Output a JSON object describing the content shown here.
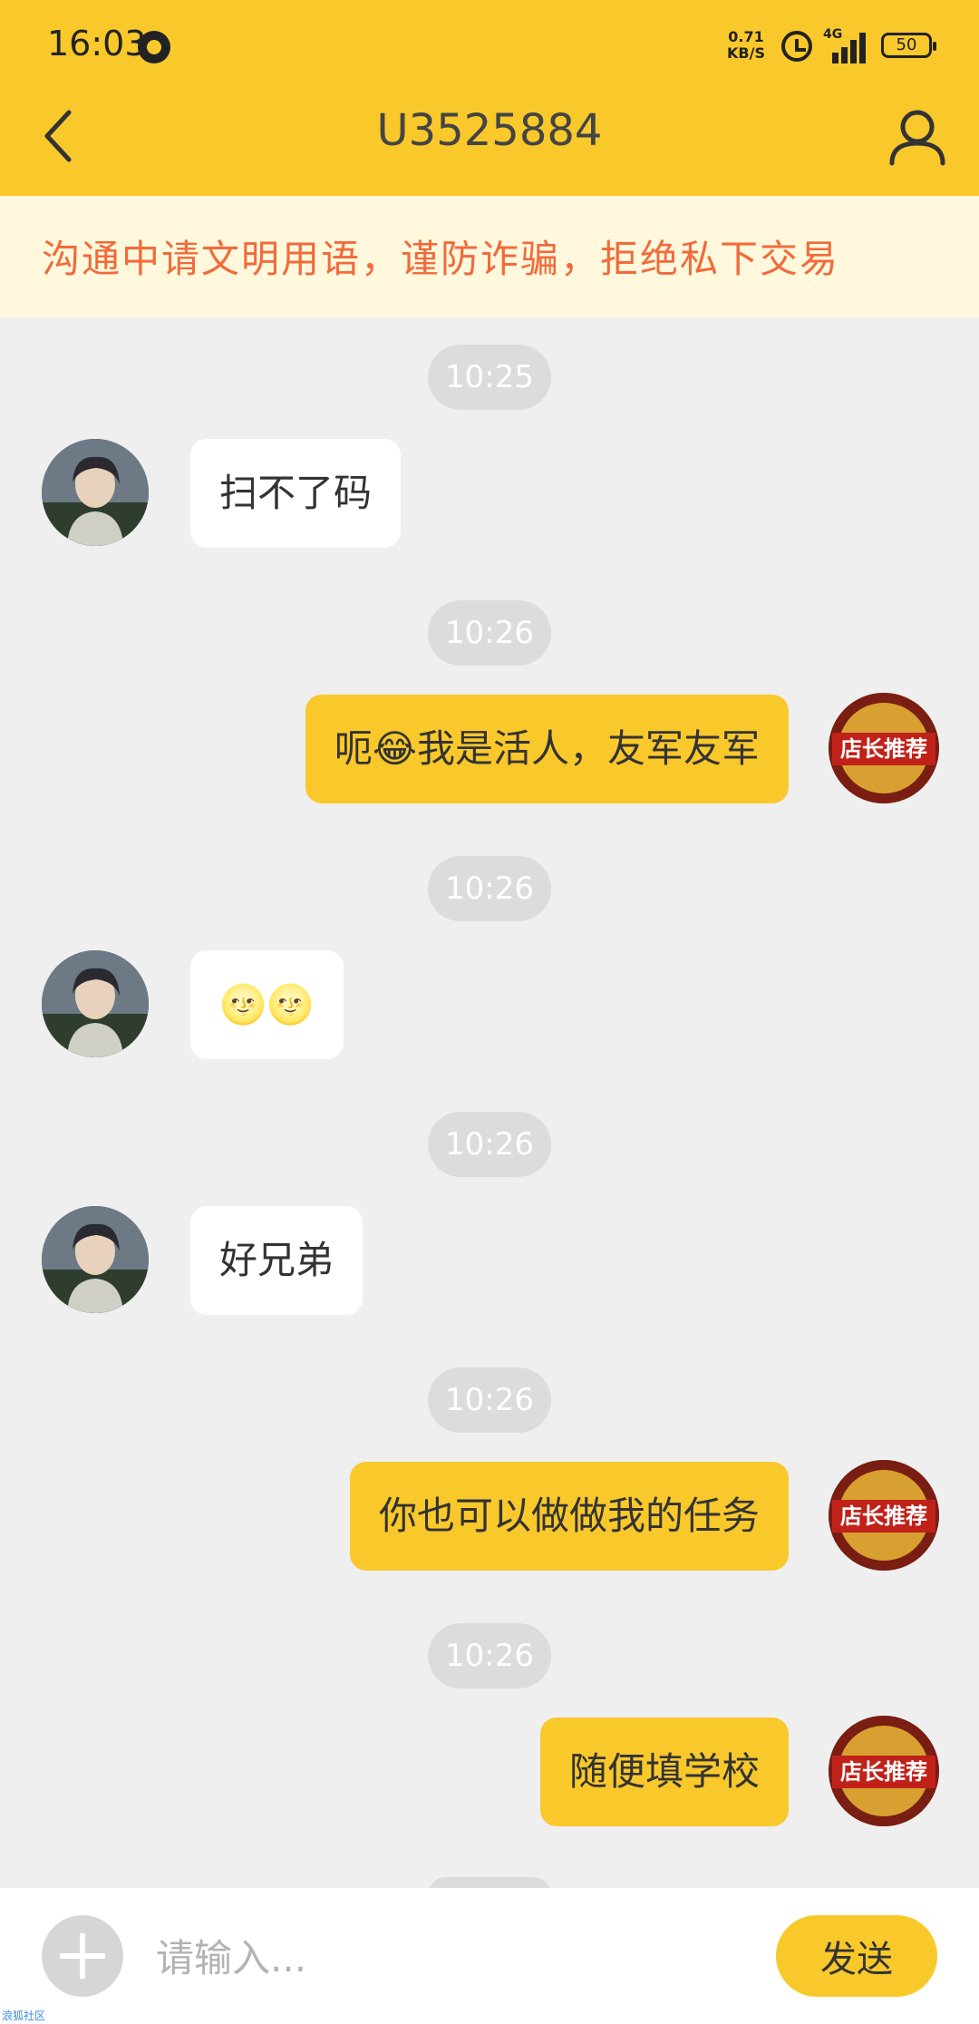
{
  "status_bar": {
    "time": "16:03",
    "net_speed_value": "0.71",
    "net_speed_unit": "KB/S",
    "network": "4G",
    "battery": "50"
  },
  "header": {
    "title": "U3525884",
    "back_icon": "back-arrow-icon",
    "profile_icon": "user-icon",
    "bg_color": "#f9c82b"
  },
  "notice": {
    "text": "沟通中请文明用语，谨防诈骗，拒绝私下交易",
    "color": "#f26a3b"
  },
  "messages": [
    {
      "time": "10:25",
      "side": "left",
      "text": "扫不了码"
    },
    {
      "time": "10:26",
      "side": "right",
      "text": "呃😂我是活人，友军友军"
    },
    {
      "time": "10:26",
      "side": "left",
      "text": "🌝🌝"
    },
    {
      "time": "10:26",
      "side": "left",
      "text": "好兄弟"
    },
    {
      "time": "10:26",
      "side": "right",
      "text": "你也可以做做我的任务"
    },
    {
      "time": "10:26",
      "side": "right",
      "text": "随便填学校"
    }
  ],
  "avatar_right_label": "店长推荐",
  "composer": {
    "placeholder": "请输入...",
    "send_label": "发送",
    "plus_icon": "plus-icon"
  },
  "watermark": "浪狐社区"
}
